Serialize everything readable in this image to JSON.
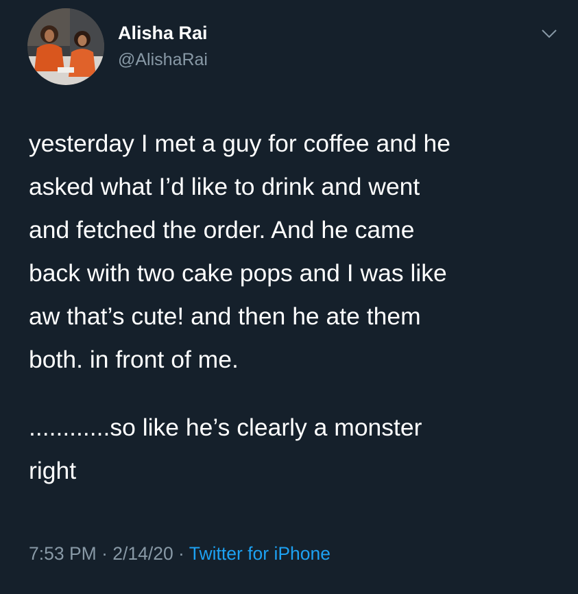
{
  "author": {
    "display_name": "Alisha Rai",
    "handle": "@AlishaRai"
  },
  "tweet": {
    "paragraph_1": "yesterday I met a guy for coffee and he\nasked what I’d like to drink and went\nand fetched the order. And he came\nback with two cake pops and I was like\naw that’s cute! and then he ate them\nboth. in front of me.",
    "paragraph_2": "............so like he’s clearly a monster\nright"
  },
  "meta": {
    "time": "7:53 PM",
    "separator_1": " · ",
    "date": "2/14/20",
    "separator_2": " · ",
    "source": "Twitter for iPhone"
  },
  "icons": {
    "more": "chevron-down-icon"
  },
  "colors": {
    "background": "#15202b",
    "text": "#ffffff",
    "secondary_text": "#8899a6",
    "link": "#1da1f2"
  }
}
